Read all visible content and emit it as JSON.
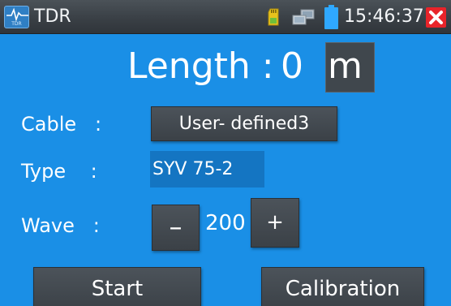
{
  "status_bar": {
    "app_title": "TDR",
    "app_icon_caption": "TDR",
    "time": "15:46:37"
  },
  "measurement": {
    "length_label": "Length : ",
    "length_value": "0",
    "unit": "m"
  },
  "cable": {
    "label": "Cable   :",
    "value": "User- defined3"
  },
  "type": {
    "label": "Type    :",
    "value": "SYV 75-2"
  },
  "wave": {
    "label": "Wave   :",
    "decrement_label": "–",
    "value": "200",
    "increment_label": "+"
  },
  "actions": {
    "start_label": "Start",
    "calibration_label": "Calibration"
  },
  "colors": {
    "background": "#1a8fe6",
    "button": "#40474d",
    "type_field": "#1475c2",
    "close": "#e8242a",
    "battery": "#2fa8ff"
  },
  "icons": [
    "tdr-app-icon",
    "sd-card-icon",
    "network-icon",
    "battery-icon",
    "close-icon"
  ]
}
